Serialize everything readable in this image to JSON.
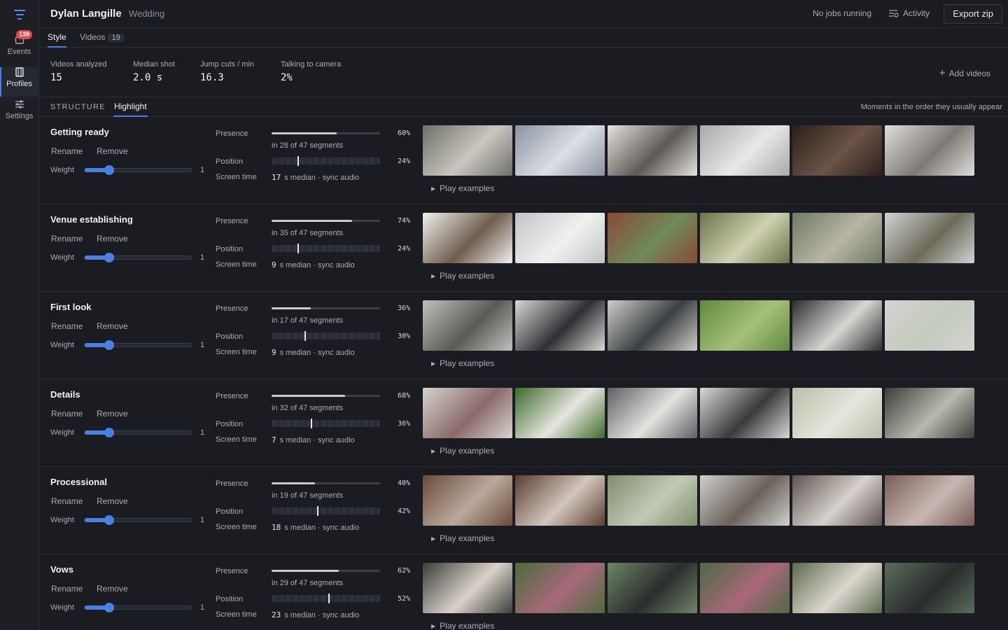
{
  "sidebar": {
    "badge": "139",
    "items": [
      {
        "label": "Events"
      },
      {
        "label": "Profiles"
      },
      {
        "label": "Settings"
      }
    ]
  },
  "header": {
    "title": "Dylan Langille",
    "subtitle": "Wedding",
    "jobs_status": "No jobs running",
    "activity_label": "Activity",
    "export_label": "Export zip"
  },
  "tabs": [
    {
      "label": "Style"
    },
    {
      "label": "Videos",
      "count": "19"
    }
  ],
  "stats": [
    {
      "label": "Videos analyzed",
      "value": "15"
    },
    {
      "label": "Median shot",
      "value": "2.0 s"
    },
    {
      "label": "Jump cuts / min",
      "value": "16.3"
    },
    {
      "label": "Talking to camera",
      "value": "2%"
    }
  ],
  "add_videos_label": "Add videos",
  "subtabs": {
    "structure": "STRUCTURE",
    "highlight": "Highlight",
    "note": "Moments in the order they usually appear"
  },
  "labels": {
    "rename": "Rename",
    "remove": "Remove",
    "weight": "Weight",
    "presence": "Presence",
    "position": "Position",
    "screen_time": "Screen time",
    "play_examples": "Play examples"
  },
  "moments": [
    {
      "name": "Getting ready",
      "weight": "1",
      "weight_level": 0.23,
      "presence": 0.6,
      "presence_pct": "60%",
      "segments": "in 28 of 47 segments",
      "position": 0.24,
      "position_pct": "24%",
      "screen_time": "17",
      "screen_time_suffix": "s median · sync audio",
      "thumb_colors": [
        [
          "#6f7068",
          "#c9c6bf"
        ],
        [
          "#8a93a2",
          "#dcdfe4"
        ],
        [
          "#e6e3df",
          "#5d5a56"
        ],
        [
          "#a8a9a6",
          "#e8e8e6"
        ],
        [
          "#2a201b",
          "#6c5347"
        ],
        [
          "#e0dedb",
          "#7d7a75"
        ]
      ]
    },
    {
      "name": "Venue establishing",
      "weight": "1",
      "weight_level": 0.23,
      "presence": 0.74,
      "presence_pct": "74%",
      "segments": "in 35 of 47 segments",
      "position": 0.24,
      "position_pct": "24%",
      "screen_time": "9",
      "screen_time_suffix": "s median · sync audio",
      "thumb_colors": [
        [
          "#f0f0ee",
          "#6e5d4d"
        ],
        [
          "#c0c3c6",
          "#f1f1f0"
        ],
        [
          "#8a4a36",
          "#6f8a5a"
        ],
        [
          "#6d7448",
          "#cfd1b1"
        ],
        [
          "#6e7b64",
          "#b9b5a6"
        ],
        [
          "#cfd3d6",
          "#6e6a5a"
        ]
      ]
    },
    {
      "name": "First look",
      "weight": "1",
      "weight_level": 0.23,
      "presence": 0.36,
      "presence_pct": "36%",
      "segments": "in 17 of 47 segments",
      "position": 0.3,
      "position_pct": "30%",
      "screen_time": "9",
      "screen_time_suffix": "s median · sync audio",
      "thumb_colors": [
        [
          "#bfc0bd",
          "#5c5a57"
        ],
        [
          "#d7d8d7",
          "#2e3033"
        ],
        [
          "#cdceca",
          "#3c3f42"
        ],
        [
          "#5f8a3d",
          "#a7c07a"
        ],
        [
          "#2c2e31",
          "#d7d6d2"
        ],
        [
          "#d2d4d1",
          "#c4cabc"
        ]
      ]
    },
    {
      "name": "Details",
      "weight": "1",
      "weight_level": 0.23,
      "presence": 0.68,
      "presence_pct": "68%",
      "segments": "in 32 of 47 segments",
      "position": 0.36,
      "position_pct": "36%",
      "screen_time": "7",
      "screen_time_suffix": "s median · sync audio",
      "thumb_colors": [
        [
          "#d8d3cd",
          "#8b6a6a"
        ],
        [
          "#3f6b2a",
          "#e6e6e0"
        ],
        [
          "#5e5f62",
          "#e3e2df"
        ],
        [
          "#d7d8d7",
          "#3a3a3b"
        ],
        [
          "#b8bfa9",
          "#e4e7dc"
        ],
        [
          "#3c3d3a",
          "#b9b9ae"
        ]
      ]
    },
    {
      "name": "Processional",
      "weight": "1",
      "weight_level": 0.23,
      "presence": 0.4,
      "presence_pct": "40%",
      "segments": "in 19 of 47 segments",
      "position": 0.42,
      "position_pct": "42%",
      "screen_time": "18",
      "screen_time_suffix": "s median · sync audio",
      "thumb_colors": [
        [
          "#6a4a3a",
          "#b9a99a"
        ],
        [
          "#5c3d33",
          "#d2c6bd"
        ],
        [
          "#7f8f6a",
          "#c2c9b6"
        ],
        [
          "#cfd0cf",
          "#6b6259"
        ],
        [
          "#5d5450",
          "#d6d1cc"
        ],
        [
          "#7a5d57",
          "#c7b7b2"
        ]
      ]
    },
    {
      "name": "Vows",
      "weight": "1",
      "weight_level": 0.23,
      "presence": 0.62,
      "presence_pct": "62%",
      "segments": "in 29 of 47 segments",
      "position": 0.52,
      "position_pct": "52%",
      "screen_time": "23",
      "screen_time_suffix": "s median · sync audio",
      "thumb_colors": [
        [
          "#3b3d3a",
          "#d9d2c9"
        ],
        [
          "#4e6a3a",
          "#a66a7c"
        ],
        [
          "#6e8563",
          "#2b2d2f"
        ],
        [
          "#4f6a43",
          "#a8677a"
        ],
        [
          "#5d6a4a",
          "#dcd7d0"
        ],
        [
          "#5a6d58",
          "#2a2c2e"
        ]
      ]
    }
  ]
}
